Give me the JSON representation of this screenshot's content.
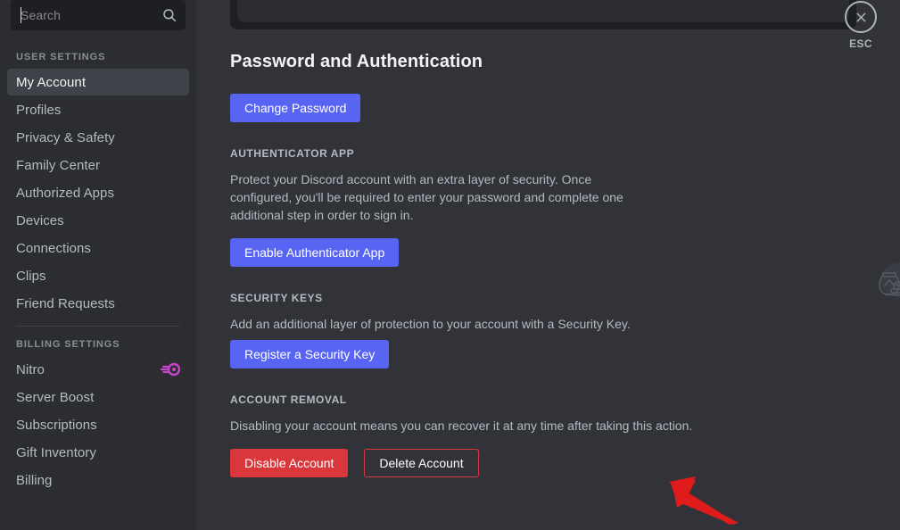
{
  "search": {
    "placeholder": "Search",
    "value": "",
    "icon": "search-icon"
  },
  "sidebar": {
    "groups": [
      {
        "header": "USER SETTINGS",
        "items": [
          {
            "label": "My Account",
            "active": true,
            "badge": null
          },
          {
            "label": "Profiles",
            "active": false,
            "badge": null
          },
          {
            "label": "Privacy & Safety",
            "active": false,
            "badge": null
          },
          {
            "label": "Family Center",
            "active": false,
            "badge": null
          },
          {
            "label": "Authorized Apps",
            "active": false,
            "badge": null
          },
          {
            "label": "Devices",
            "active": false,
            "badge": null
          },
          {
            "label": "Connections",
            "active": false,
            "badge": null
          },
          {
            "label": "Clips",
            "active": false,
            "badge": null
          },
          {
            "label": "Friend Requests",
            "active": false,
            "badge": null
          }
        ]
      },
      {
        "header": "BILLING SETTINGS",
        "items": [
          {
            "label": "Nitro",
            "active": false,
            "badge": "nitro-boost-icon"
          },
          {
            "label": "Server Boost",
            "active": false,
            "badge": null
          },
          {
            "label": "Subscriptions",
            "active": false,
            "badge": null
          },
          {
            "label": "Gift Inventory",
            "active": false,
            "badge": null
          },
          {
            "label": "Billing",
            "active": false,
            "badge": null
          }
        ]
      }
    ]
  },
  "main": {
    "section_title": "Password and Authentication",
    "change_password_label": "Change Password",
    "authenticator": {
      "header": "AUTHENTICATOR APP",
      "description": "Protect your Discord account with an extra layer of security. Once configured, you'll be required to enter your password and complete one additional step in order to sign in.",
      "button_label": "Enable Authenticator App"
    },
    "security_keys": {
      "header": "SECURITY KEYS",
      "description": "Add an additional layer of protection to your account with a Security Key.",
      "button_label": "Register a Security Key"
    },
    "account_removal": {
      "header": "ACCOUNT REMOVAL",
      "description": "Disabling your account means you can recover it at any time after taking this action.",
      "disable_label": "Disable Account",
      "delete_label": "Delete Account"
    },
    "illustration": "treasure-chest-vault-illustration"
  },
  "close": {
    "icon": "close-icon",
    "label": "ESC"
  },
  "annotation": {
    "arrow": "red-pointer-arrow",
    "target": "Delete Account"
  },
  "colors": {
    "blurple": "#5865f2",
    "danger": "#da373c",
    "sidebar_bg": "#2b2d31",
    "main_bg": "#313338",
    "search_bg": "#1e1f22",
    "active_item_bg": "#3f4248",
    "text_primary": "#f2f3f5",
    "text_muted": "#b5bac1",
    "annotation_red": "#e01b1b",
    "nitro_pink": "#c645c8"
  }
}
